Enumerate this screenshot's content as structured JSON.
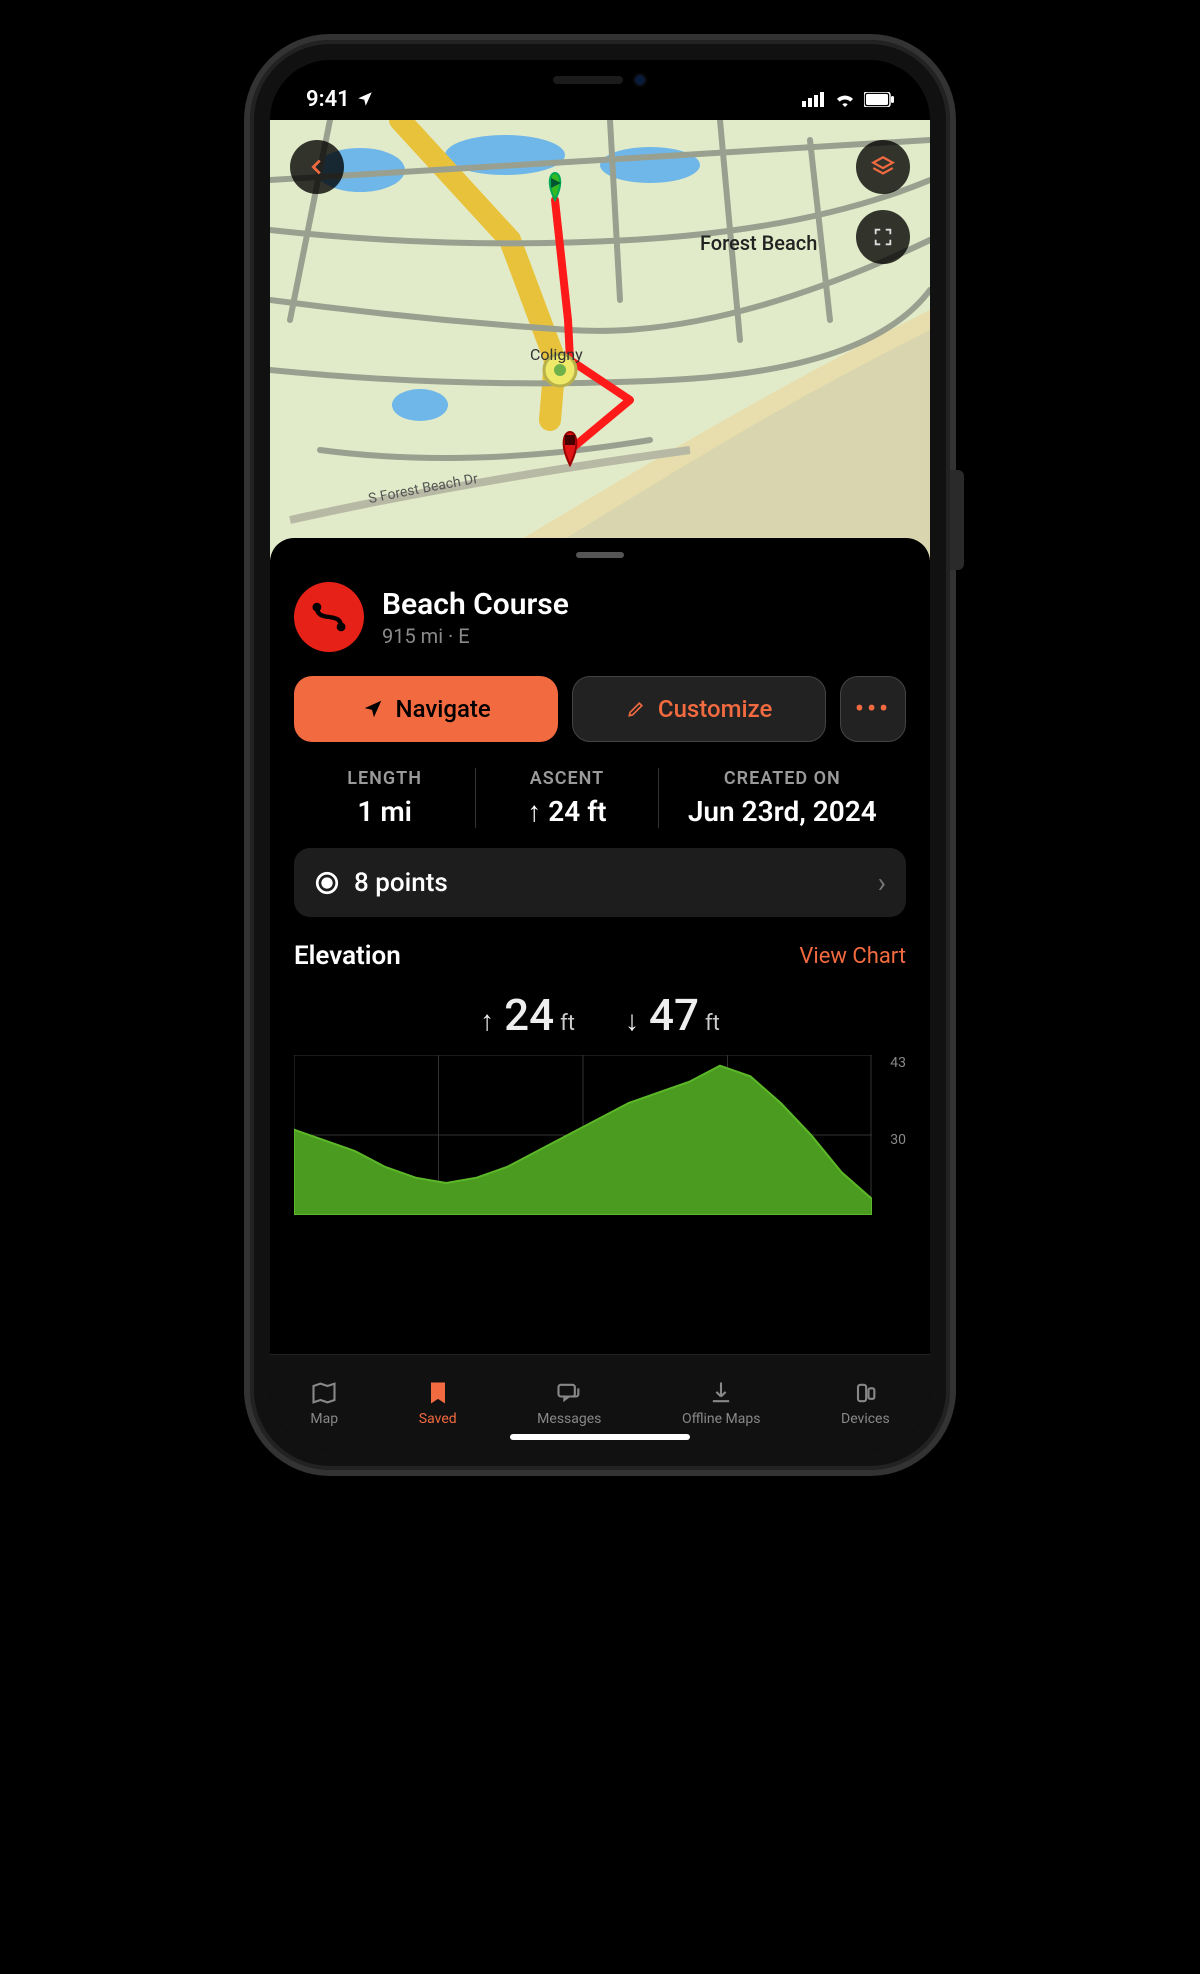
{
  "status": {
    "time": "9:41"
  },
  "map": {
    "label_forest_beach": "Forest Beach",
    "label_coligny": "Coligny",
    "label_road": "S Forest Beach Dr"
  },
  "course": {
    "title": "Beach Course",
    "subtitle": "915 mi · E"
  },
  "actions": {
    "navigate": "Navigate",
    "customize": "Customize",
    "more": "•••"
  },
  "stats": {
    "length_label": "LENGTH",
    "length_value": "1 mi",
    "ascent_label": "ASCENT",
    "ascent_value": "↑ 24 ft",
    "created_label": "CREATED ON",
    "created_value": "Jun 23rd, 2024"
  },
  "points": {
    "label": "8 points"
  },
  "elevation": {
    "heading": "Elevation",
    "view_chart": "View Chart",
    "gain_value": "24",
    "gain_unit": "ft",
    "loss_value": "47",
    "loss_unit": "ft",
    "y_top": "43",
    "y_mid": "30"
  },
  "tabs": {
    "map": "Map",
    "saved": "Saved",
    "messages": "Messages",
    "offline": "Offline Maps",
    "devices": "Devices"
  },
  "chart_data": {
    "type": "area",
    "title": "Elevation",
    "ylabel": "ft",
    "ylim": [
      15,
      45
    ],
    "x": [
      0,
      1,
      2,
      3,
      4,
      5,
      6,
      7,
      8,
      9,
      10,
      11,
      12,
      13,
      14,
      15,
      16,
      17,
      18,
      19
    ],
    "values": [
      31,
      29,
      27,
      24,
      22,
      21,
      22,
      24,
      27,
      30,
      33,
      36,
      38,
      40,
      43,
      41,
      36,
      30,
      23,
      18
    ]
  }
}
